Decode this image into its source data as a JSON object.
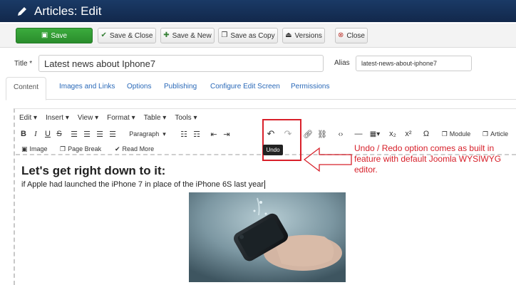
{
  "header": {
    "title": "Articles: Edit",
    "icon": "pencil-icon"
  },
  "toolbar": {
    "save": "Save",
    "save_close": "Save & Close",
    "save_new": "Save & New",
    "save_copy": "Save as Copy",
    "versions": "Versions",
    "close": "Close"
  },
  "form": {
    "title_label": "Title *",
    "title_value": "Latest news about Iphone7",
    "alias_label": "Alias",
    "alias_value": "latest-news-about-iphone7"
  },
  "tabs": [
    "Content",
    "Images and Links",
    "Options",
    "Publishing",
    "Configure Edit Screen",
    "Permissions"
  ],
  "editor": {
    "menus": [
      "Edit ▾",
      "Insert ▾",
      "View ▾",
      "Format ▾",
      "Table ▾",
      "Tools ▾"
    ],
    "paragraph": "Paragraph",
    "module": "Module",
    "article": "Article",
    "image": "Image",
    "page_break": "Page Break",
    "read_more": "Read More",
    "undo_tooltip": "Undo"
  },
  "content": {
    "heading": "Let's get right down to it:",
    "paragraph": "if Apple had launched the iPhone 7 in place of the iPhone 6S last year"
  },
  "annotation": "Undo / Redo option comes as built in feature with default Joomla WYSIWYG editor.",
  "colors": {
    "header_bg": "#1a3a66",
    "save_green": "#3bab3d",
    "annotation_red": "#d7202a",
    "link_blue": "#2a69b8"
  }
}
